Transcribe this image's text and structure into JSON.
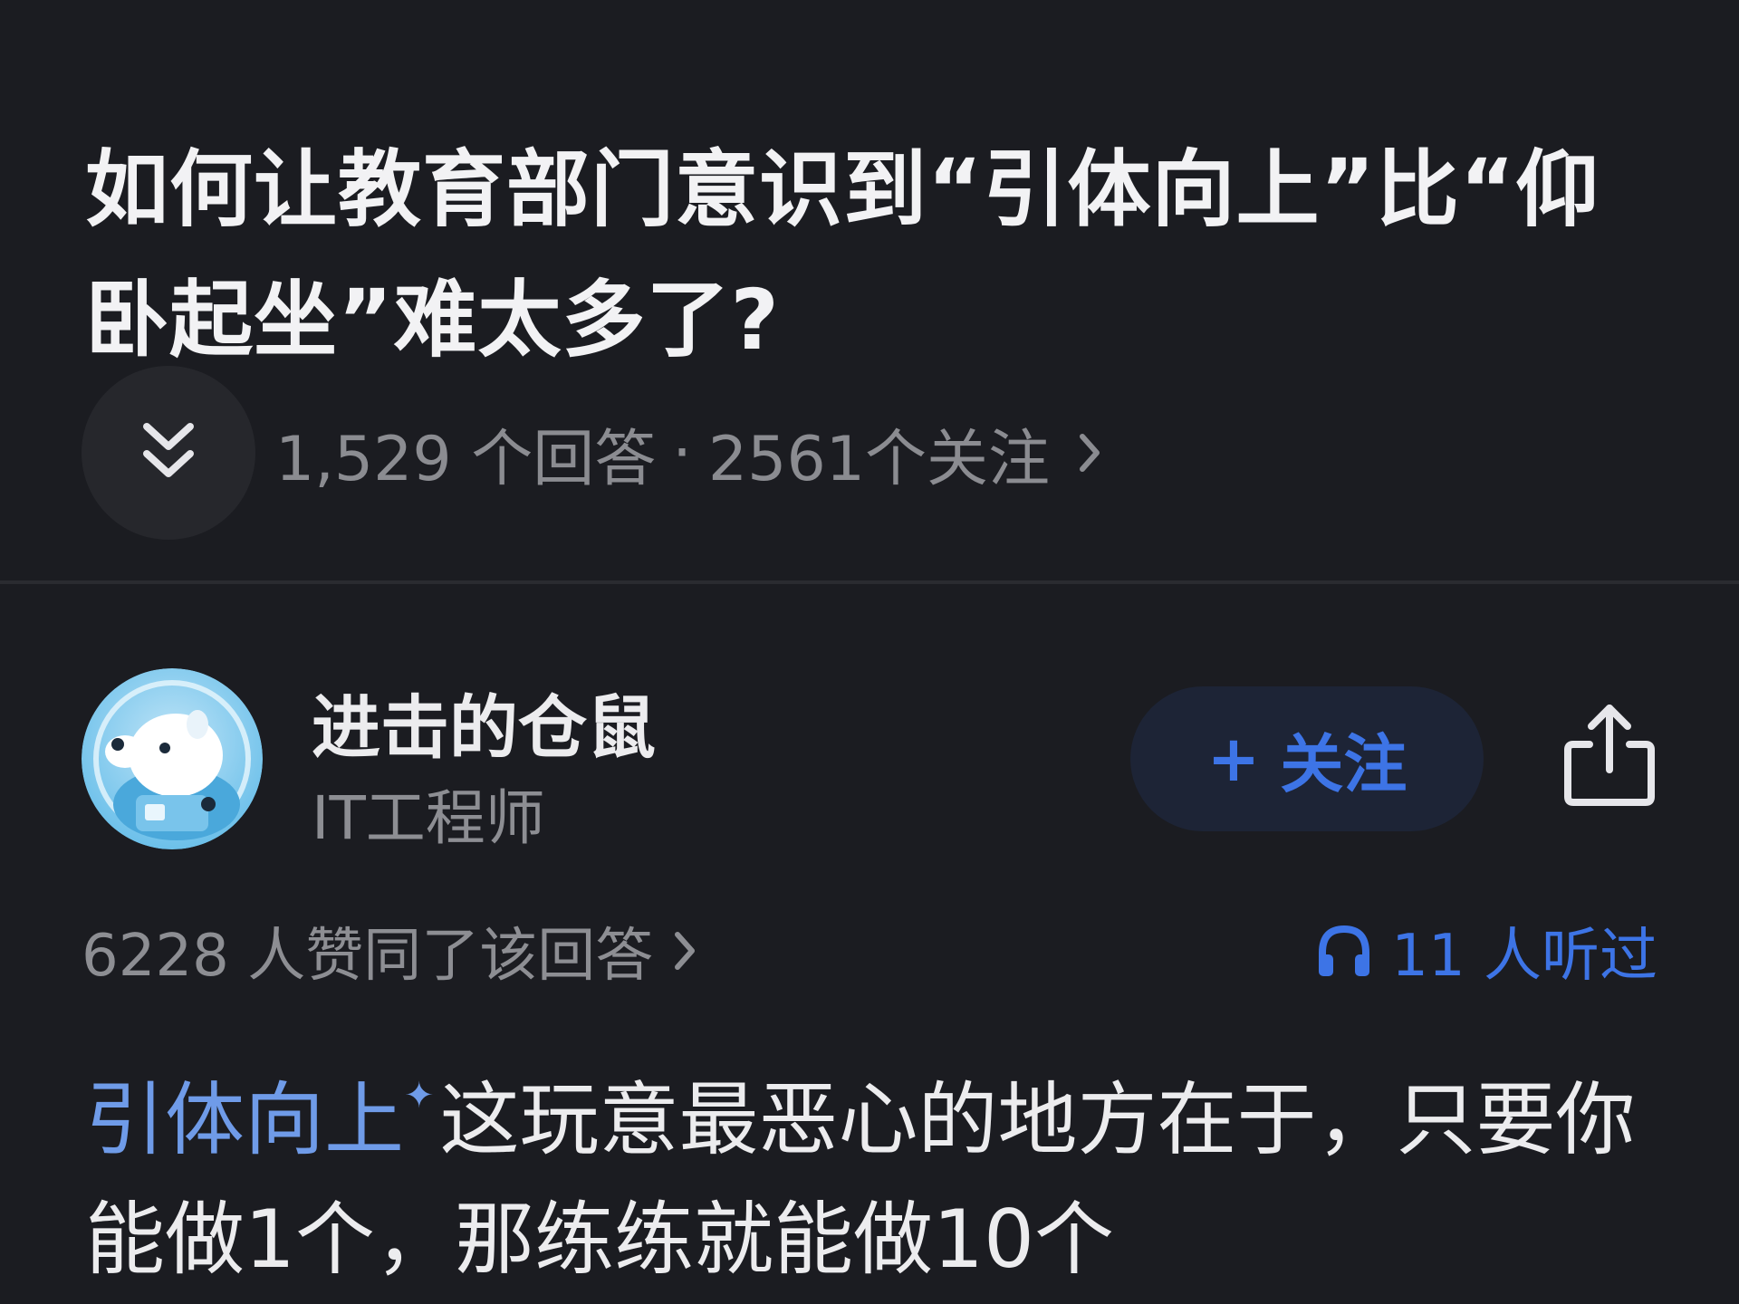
{
  "question": {
    "title": "如何让教育部门意识到“引体向上”比“仰卧起坐”难太多了?",
    "answers_count": "1,529 个回答",
    "separator": "·",
    "followers_count": "2561个关注"
  },
  "author": {
    "name": "进击的仓鼠",
    "title": "IT工程师",
    "follow_label": "+ 关注",
    "follow_plus": "+",
    "follow_text": "关注"
  },
  "stats": {
    "likes": "6228 人赞同了该回答",
    "listened": "11 人听过"
  },
  "answer": {
    "link_text": "引体向上",
    "body": "这玩意最恶心的地方在于，只要你能做1个，那练练就能做10个"
  },
  "colors": {
    "background": "#1b1c21",
    "accent_blue": "#3d74e6",
    "link_blue": "#6f9be8",
    "muted_text": "#8d8e93"
  },
  "icons": {
    "collapse": "double-chevron-down-icon",
    "chevron": "chevron-right-icon",
    "share": "share-icon",
    "headphones": "headphones-icon",
    "spark": "sparkle-icon"
  }
}
